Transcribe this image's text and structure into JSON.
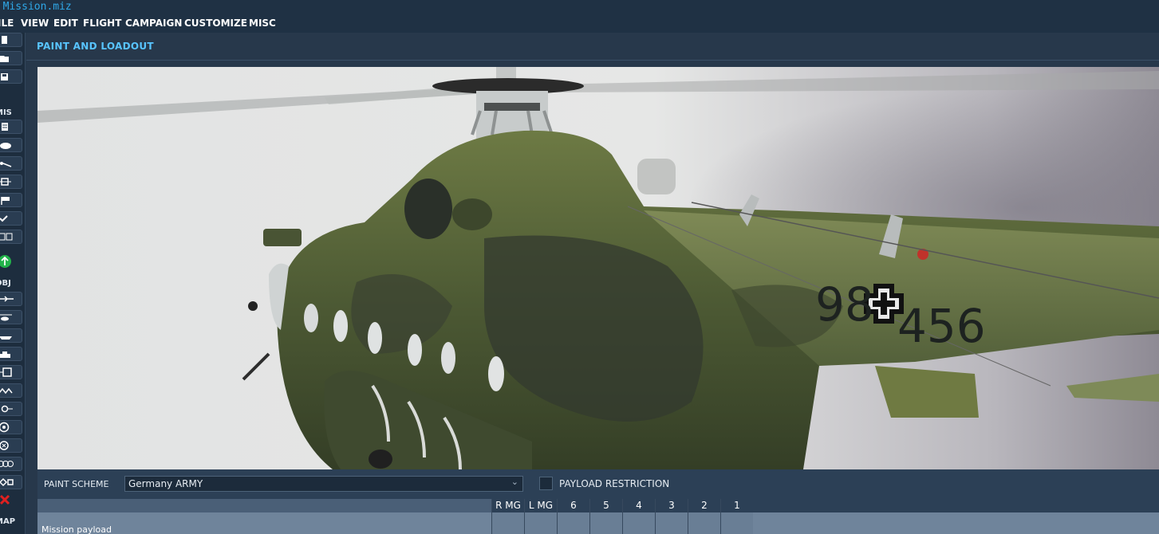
{
  "window": {
    "title": "w Mission.miz"
  },
  "menu": [
    "ILE",
    "VIEW",
    "EDIT",
    "FLIGHT",
    "CAMPAIGN",
    "CUSTOMIZE",
    "MISC"
  ],
  "toolbar": {
    "section_labels": {
      "mis": "MIS",
      "obj": "OBJ",
      "map": "MAP"
    },
    "icons": [
      "new-file-icon",
      "open-folder-icon",
      "save-icon",
      "briefing-icon",
      "weather-icon",
      "triggers-icon",
      "resources-icon",
      "flag-icon",
      "checkmark-icon",
      "options-icon",
      "go-icon",
      "airplane-icon",
      "helicopter-icon",
      "ship-icon",
      "vehicle-icon",
      "static-icon",
      "template-icon",
      "waypoint-icon",
      "target-icon",
      "circle-icon",
      "chain-icon",
      "zone-icon",
      "delete-icon"
    ]
  },
  "panel": {
    "title": "PAINT AND LOADOUT",
    "preview": {
      "tail_number_left": "98",
      "tail_number_right": "456"
    },
    "paint_scheme_label": "PAINT SCHEME",
    "paint_scheme_value": "Germany ARMY",
    "payload_restriction_label": "PAYLOAD RESTRICTION",
    "payload_restriction_checked": false,
    "pylon_columns": [
      "R MG",
      "L MG",
      "6",
      "5",
      "4",
      "3",
      "2",
      "1"
    ],
    "row_label": "Mission payload"
  },
  "colors": {
    "accent_title": "#58c4ff",
    "window_title": "#2fa8e8",
    "background": "#27384b"
  }
}
